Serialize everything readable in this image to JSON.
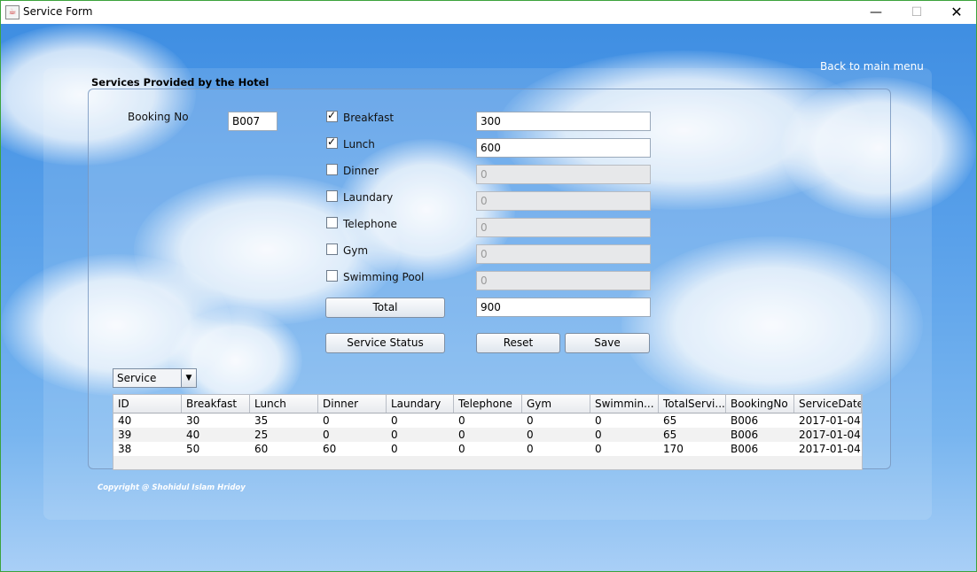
{
  "window": {
    "title": "Service Form",
    "min_icon": "minimize-icon",
    "max_icon": "maximize-icon",
    "close_icon": "close-icon"
  },
  "header": {
    "back_link": "Back to main menu",
    "section_title": "Services Provided by the Hotel"
  },
  "form": {
    "booking_label": "Booking No",
    "booking_value": "B007",
    "services": [
      {
        "label": "Breakfast",
        "checked": true,
        "value": "300",
        "enabled": true
      },
      {
        "label": "Lunch",
        "checked": true,
        "value": "600",
        "enabled": true
      },
      {
        "label": "Dinner",
        "checked": false,
        "value": "0",
        "enabled": false
      },
      {
        "label": "Laundary",
        "checked": false,
        "value": "0",
        "enabled": false
      },
      {
        "label": "Telephone",
        "checked": false,
        "value": "0",
        "enabled": false
      },
      {
        "label": "Gym",
        "checked": false,
        "value": "0",
        "enabled": false
      },
      {
        "label": "Swimming Pool",
        "checked": false,
        "value": "0",
        "enabled": false
      }
    ],
    "total_button": "Total",
    "total_value": "900",
    "status_button": "Service Status",
    "reset_button": "Reset",
    "save_button": "Save"
  },
  "filter": {
    "selected": "Service"
  },
  "table": {
    "columns": [
      "ID",
      "Breakfast",
      "Lunch",
      "Dinner",
      "Laundary",
      "Telephone",
      "Gym",
      "Swimmin...",
      "TotalServi...",
      "BookingNo",
      "ServiceDate"
    ],
    "rows": [
      [
        "40",
        "30",
        "35",
        "0",
        "0",
        "0",
        "0",
        "0",
        "65",
        "B006",
        "2017-01-04"
      ],
      [
        "39",
        "40",
        "25",
        "0",
        "0",
        "0",
        "0",
        "0",
        "65",
        "B006",
        "2017-01-04"
      ],
      [
        "38",
        "50",
        "60",
        "60",
        "0",
        "0",
        "0",
        "0",
        "170",
        "B006",
        "2017-01-04"
      ]
    ]
  },
  "footer": {
    "copyright": "Copyright @ Shohidul Islam Hridoy"
  }
}
